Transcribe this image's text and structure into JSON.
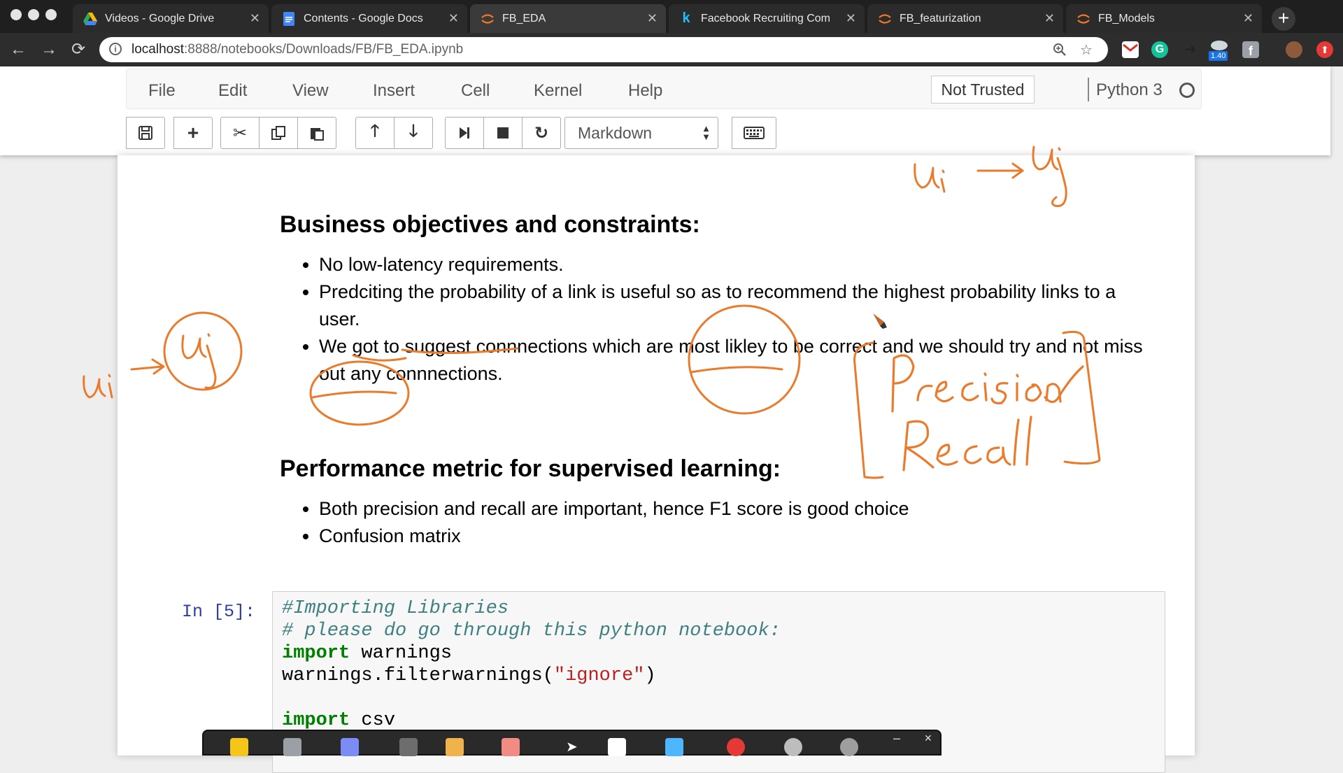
{
  "browser": {
    "tabs": [
      {
        "title": "Videos - Google Drive",
        "icon": "google-drive-icon",
        "active": false
      },
      {
        "title": "Contents - Google Docs",
        "icon": "google-docs-icon",
        "active": false
      },
      {
        "title": "FB_EDA",
        "icon": "jupyter-icon",
        "active": true
      },
      {
        "title": "Facebook Recruiting Com",
        "icon": "kaggle-icon",
        "active": false
      },
      {
        "title": "FB_featurization",
        "icon": "jupyter-icon",
        "active": false
      },
      {
        "title": "FB_Models",
        "icon": "jupyter-icon",
        "active": false
      }
    ],
    "url_host": "localhost",
    "url_path": ":8888/notebooks/Downloads/FB/FB_EDA.ipynb",
    "extension_badge": "1.40"
  },
  "jupyter": {
    "menu": [
      "File",
      "Edit",
      "View",
      "Insert",
      "Cell",
      "Kernel",
      "Help"
    ],
    "trust_label": "Not Trusted",
    "kernel_name": "Python 3",
    "cell_type": "Markdown"
  },
  "notebook": {
    "section1": {
      "heading": "Business objectives and constraints:",
      "bullets": [
        "No low-latency requirements.",
        "Predciting the probability of a link is useful so as to recommend the highest probability links to a user.",
        "We got to suggest connnections which are most likley to be correct and we should try and not miss out any connnections."
      ]
    },
    "section2": {
      "heading": "Performance metric for supervised learning:",
      "bullets": [
        "Both precision and recall are important, hence F1 score is good choice",
        "Confusion matrix"
      ]
    },
    "code_cell": {
      "prompt": "In [5]:",
      "comment1": "#Importing Libraries",
      "comment2": "# please do go through this python notebook:",
      "kw_import": "import",
      "mod_warnings": " warnings",
      "filter_prefix": "warnings.filterwarnings(",
      "filter_arg": "\"ignore\"",
      "filter_suffix": ")",
      "mod_csv": " csv"
    }
  },
  "colors": {
    "ink": "#ea7b2c",
    "prompt": "#303f9f",
    "comment": "#408080",
    "keyword": "#008000",
    "string": "#ba2121"
  }
}
